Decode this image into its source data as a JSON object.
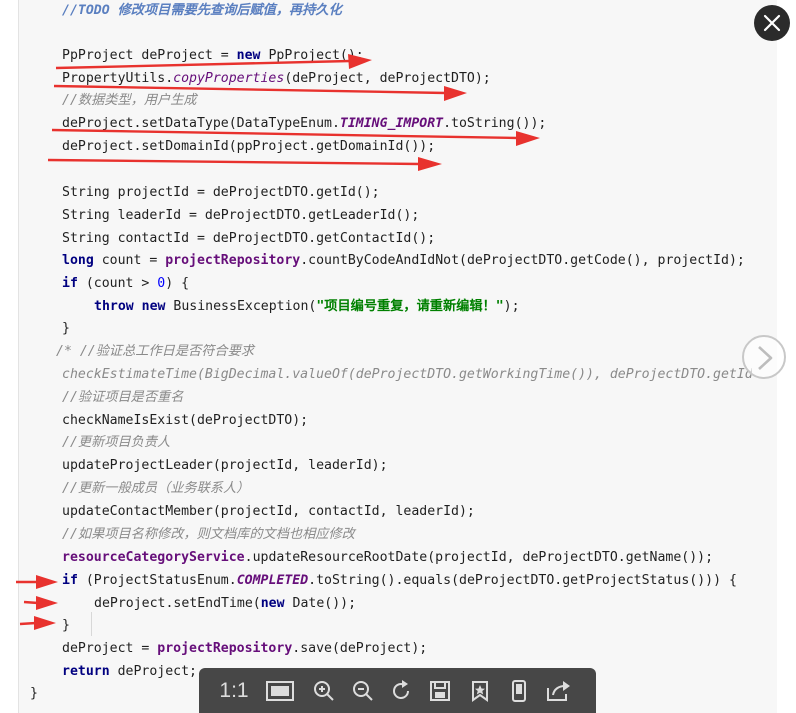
{
  "code": {
    "todo_comment": "//TODO 修改项目需要先查询后赋值，再持久化",
    "l1_a": "PpProject deProject = ",
    "l1_new": "new",
    "l1_b": " PpProject();",
    "l2_a": "PropertyUtils.",
    "l2_fn": "copyProperties",
    "l2_b": "(deProject, deProjectDTO);",
    "l3_comment": "//数据类型，用户生成",
    "l4_a": "deProject.setDataType(DataTypeEnum.",
    "l4_const": "TIMING_IMPORT",
    "l4_b": ".toString());",
    "l5": "deProject.setDomainId(ppProject.getDomainId());",
    "l6": "String projectId = deProjectDTO.getId();",
    "l7": "String leaderId = deProjectDTO.getLeaderId();",
    "l8": "String contactId = deProjectDTO.getContactId();",
    "l9_kw": "long",
    "l9_a": " count = ",
    "l9_field": "projectRepository",
    "l9_b": ".countByCodeAndIdNot(deProjectDTO.getCode(), projectId);",
    "l10_kw": "if",
    "l10_a": " (count > ",
    "l10_num": "0",
    "l10_b": ") {",
    "l11_kw1": "throw",
    "l11_kw2": "new",
    "l11_a": " BusinessException(",
    "l11_str": "\"项目编号重复，请重新编辑！\"",
    "l11_b": ");",
    "l12": "}",
    "l13_comment": "/* //验证总工作日是否符合要求",
    "l14_comment": "checkEstimateTime(BigDecimal.valueOf(deProjectDTO.getWorkingTime()), deProjectDTO.getId());*/",
    "l15_comment": "//验证项目是否重名",
    "l16": "checkNameIsExist(deProjectDTO);",
    "l17_comment": "//更新项目负责人",
    "l18": "updateProjectLeader(projectId, leaderId);",
    "l19_comment": "//更新一般成员（业务联系人）",
    "l20": "updateContactMember(projectId, contactId, leaderId);",
    "l21_comment": "//如果项目名称修改，则文档库的文档也相应修改",
    "l22_field": "resourceCategoryService",
    "l22_a": ".updateResourceRootDate(projectId, deProjectDTO.getName());",
    "l23_kw": "if",
    "l23_a": " (ProjectStatusEnum.",
    "l23_const": "COMPLETED",
    "l23_b": ".toString().equals(deProjectDTO.getProjectStatus())) {",
    "l24_a": "deProject.setEndTime(",
    "l24_new": "new",
    "l24_b": " Date());",
    "l25": "}",
    "l26_a": "deProject = ",
    "l26_field": "projectRepository",
    "l26_b": ".save(deProject);",
    "l27_kw": "return",
    "l27_a": " deProject;",
    "l28": "}"
  },
  "viewer": {
    "close_icon": "close-x-icon",
    "next_icon": "chevron-right-icon",
    "annotation_color": "#e8322e"
  },
  "toolbar": {
    "actual_size_label": "1:1",
    "icons": [
      "fit-screen-icon",
      "zoom-in-icon",
      "zoom-out-icon",
      "rotate-icon",
      "save-icon",
      "bookmark-icon",
      "mobile-icon",
      "share-icon"
    ]
  }
}
